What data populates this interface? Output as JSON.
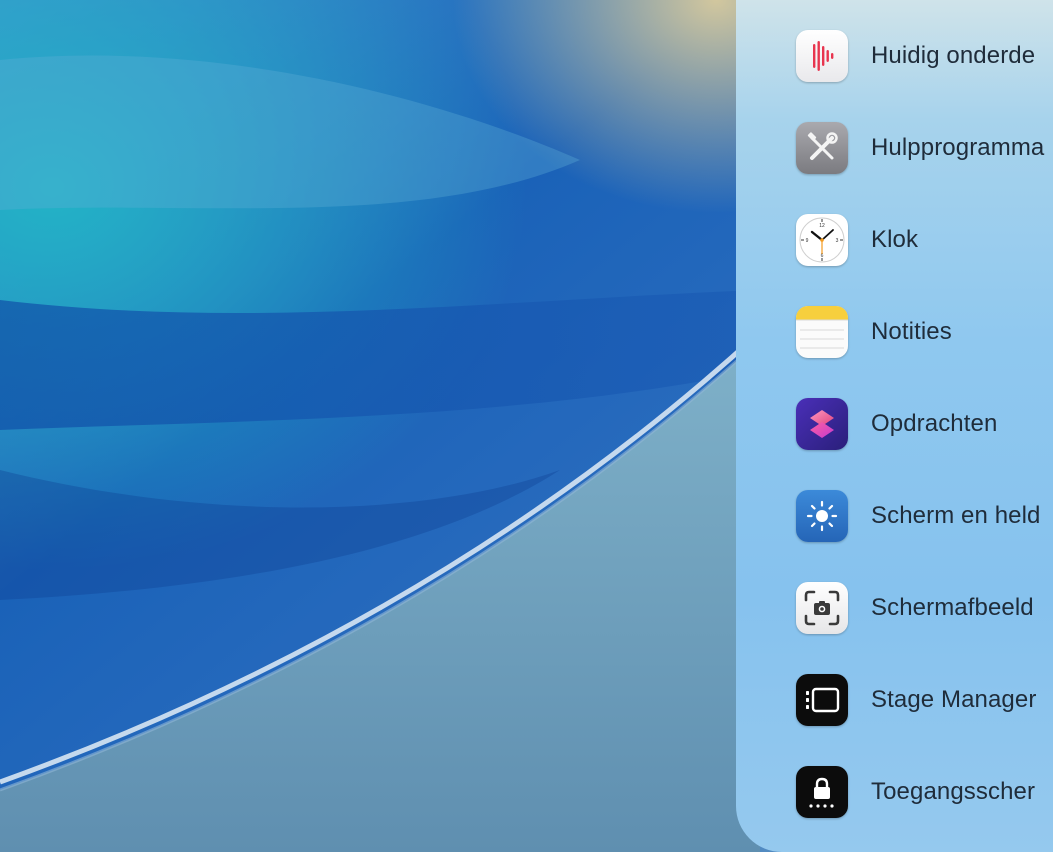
{
  "launcher": {
    "items": [
      {
        "label": "Huidig onderde",
        "icon": "voice-memos-icon"
      },
      {
        "label": "Hulpprogramma",
        "icon": "utilities-icon"
      },
      {
        "label": "Klok",
        "icon": "clock-icon"
      },
      {
        "label": "Notities",
        "icon": "notes-icon"
      },
      {
        "label": "Opdrachten",
        "icon": "shortcuts-icon"
      },
      {
        "label": "Scherm en held",
        "icon": "brightness-icon"
      },
      {
        "label": "Schermafbeeld",
        "icon": "screenshot-icon"
      },
      {
        "label": "Stage Manager",
        "icon": "stage-manager-icon"
      },
      {
        "label": "Toegangsscher",
        "icon": "lock-screen-icon"
      }
    ]
  },
  "colors": {
    "panel_bg": "#8fc8ef",
    "label_text": "#1f2c3a",
    "voice_memo_accent": "#e8354f",
    "shortcuts_gradient": [
      "#e4407a",
      "#5b3bc7"
    ]
  }
}
